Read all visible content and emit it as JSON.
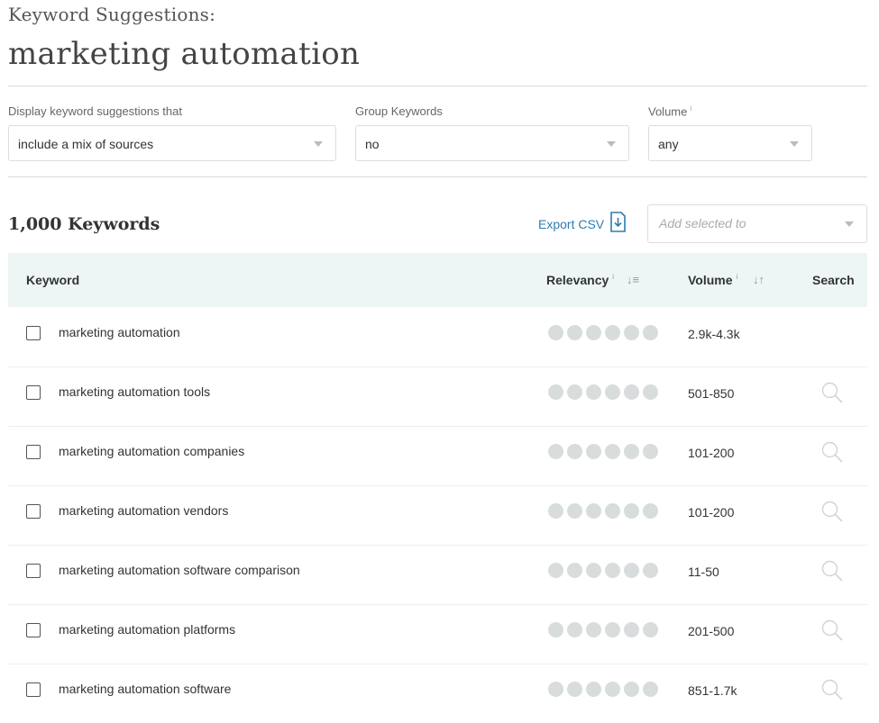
{
  "header": {
    "subtitle": "Keyword Suggestions:",
    "title": "marketing automation"
  },
  "filters": {
    "display": {
      "label": "Display keyword suggestions that",
      "value": "include a mix of sources"
    },
    "group": {
      "label": "Group Keywords",
      "value": "no"
    },
    "volume": {
      "label": "Volume",
      "info": "i",
      "value": "any"
    }
  },
  "toolbar": {
    "count": "1,000 Keywords",
    "export_label": "Export CSV",
    "add_selected_placeholder": "Add selected to"
  },
  "table": {
    "columns": {
      "keyword": "Keyword",
      "relevancy": "Relevancy",
      "volume": "Volume",
      "search": "Search",
      "info": "i"
    },
    "rows": [
      {
        "keyword": "marketing automation",
        "volume": "2.9k-4.3k"
      },
      {
        "keyword": "marketing automation tools",
        "volume": "501-850"
      },
      {
        "keyword": "marketing automation companies",
        "volume": "101-200"
      },
      {
        "keyword": "marketing automation vendors",
        "volume": "101-200"
      },
      {
        "keyword": "marketing automation software comparison",
        "volume": "11-50"
      },
      {
        "keyword": "marketing automation platforms",
        "volume": "201-500"
      },
      {
        "keyword": "marketing automation software",
        "volume": "851-1.7k"
      }
    ]
  },
  "colors": {
    "accent": "#2f7cb0",
    "table_header_bg": "#eef5f5",
    "relevancy_dot": "#d8dcdc"
  }
}
